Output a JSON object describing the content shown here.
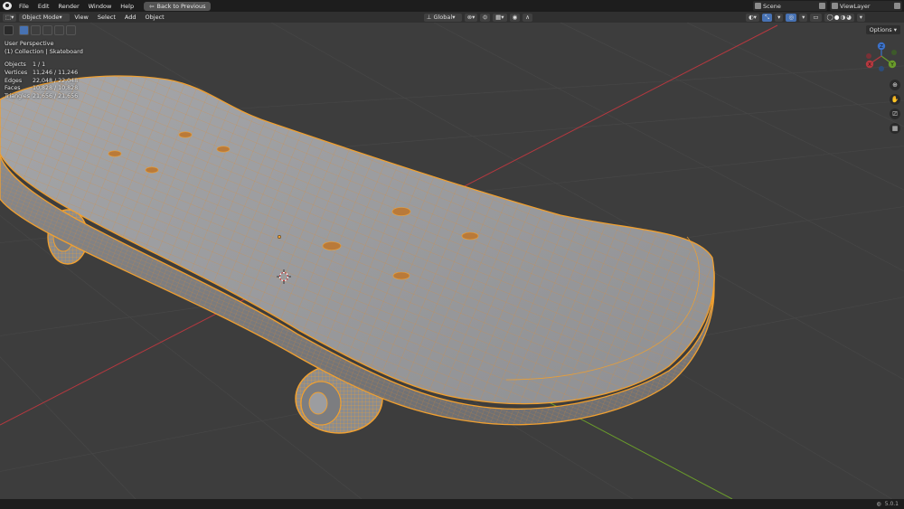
{
  "topbar": {
    "menus": [
      "File",
      "Edit",
      "Render",
      "Window",
      "Help"
    ],
    "back_button": "Back to Previous",
    "scene": "Scene",
    "view_layer": "ViewLayer"
  },
  "header": {
    "mode": "Object Mode",
    "menus": [
      "View",
      "Select",
      "Add",
      "Object"
    ],
    "transform_orientation": "Global",
    "options": "Options"
  },
  "viewport": {
    "view_name": "User Perspective",
    "collection_path": "(1) Collection | Skateboard",
    "stats": [
      {
        "label": "Objects",
        "value": "1 / 1"
      },
      {
        "label": "Vertices",
        "value": "11,246 / 11,246"
      },
      {
        "label": "Edges",
        "value": "22,048 / 22,048"
      },
      {
        "label": "Faces",
        "value": "10,828 / 10,828"
      },
      {
        "label": "Triangles",
        "value": "21,656 / 21,656"
      }
    ],
    "gizmo_axes": [
      "Z",
      "Y",
      "X"
    ]
  },
  "status": {
    "version": "5.0.1"
  },
  "colors": {
    "background": "#3d3d3d",
    "selection": "#f0a030",
    "x_axis": "#b5383f",
    "y_axis": "#6a9c2b",
    "deck": "#9a9b9e"
  }
}
